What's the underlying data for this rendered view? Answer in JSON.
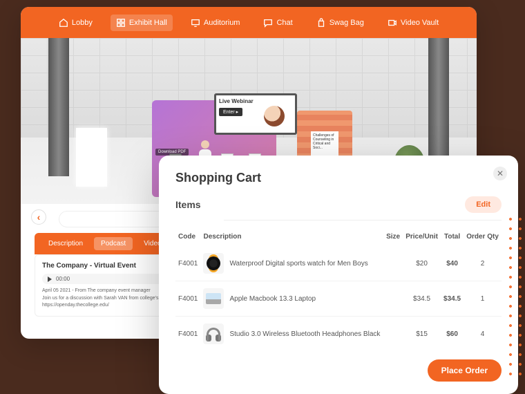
{
  "nav": [
    {
      "icon": "home",
      "label": "Lobby"
    },
    {
      "icon": "grid",
      "label": "Exhibit Hall"
    },
    {
      "icon": "monitor",
      "label": "Auditorium"
    },
    {
      "icon": "chat",
      "label": "Chat"
    },
    {
      "icon": "bag",
      "label": "Swag Bag"
    },
    {
      "icon": "video",
      "label": "Video Vault"
    }
  ],
  "booth": {
    "webinar_label": "Live Webinar",
    "enter_label": "Enter ▸",
    "download_label": "Download PDF",
    "side_text": "Challenges of Counseling in Critical and Soci..."
  },
  "tabs": [
    "Description",
    "Podcast",
    "Videos"
  ],
  "detail": {
    "title": "The Company - Virtual Event",
    "audio_time": "00:00",
    "meta": "April 05 2021 - From The company event manager",
    "desc": "Join us for a discussion with Sarah VAN from college's Center for G... tional communities: https://openday.thecollege.edu/"
  },
  "cart": {
    "title": "Shopping Cart",
    "items_label": "Items",
    "edit_label": "Edit",
    "place_order_label": "Place Order",
    "columns": [
      "Code",
      "Description",
      "Size",
      "Price/Unit",
      "Total",
      "Order Qty"
    ],
    "rows": [
      {
        "code": "F4001",
        "desc": "Waterproof Digital sports watch for Men Boys",
        "size": "",
        "price": "$20",
        "total": "$40",
        "qty": "2",
        "thumb": "watch"
      },
      {
        "code": "F4001",
        "desc": "Apple Macbook 13.3 Laptop",
        "size": "",
        "price": "$34.5",
        "total": "$34.5",
        "qty": "1",
        "thumb": "laptop"
      },
      {
        "code": "F4001",
        "desc": "Studio 3.0 Wireless Bluetooth Headphones Black",
        "size": "",
        "price": "$15",
        "total": "$60",
        "qty": "4",
        "thumb": "headphones"
      }
    ]
  }
}
